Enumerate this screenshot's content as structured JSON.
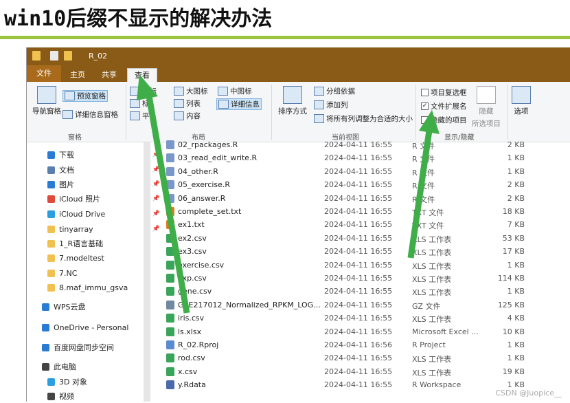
{
  "slide_title": "win10后缀不显示的解决办法",
  "window": {
    "title": "R_02"
  },
  "tabs": [
    "文件",
    "主页",
    "共享",
    "查看"
  ],
  "ribbon": {
    "pane": {
      "nav_pane": "导航窗格",
      "preview_pane": "预览窗格",
      "details_pane": "详细信息窗格",
      "group": "窗格"
    },
    "layout": {
      "medium_icons": "图标",
      "large_icons": "大图标",
      "list": "列表",
      "content": "内容",
      "tiles": "标",
      "small": "平",
      "med_icons2": "中图标",
      "details": "详细信息",
      "group": "布局"
    },
    "current_view": {
      "sort": "排序方式",
      "group_by": "分组依据",
      "add_column": "添加列",
      "fit_columns": "将所有列调整为合适的大小",
      "group": "当前视图"
    },
    "show_hide": {
      "item_checkboxes": "项目复选框",
      "file_ext": "文件扩展名",
      "hidden_items": "隐藏的项目",
      "hide": "隐藏",
      "hide_sel": "所选项目",
      "options": "选项",
      "group": "显示/隐藏"
    }
  },
  "nav": [
    {
      "label": "下载",
      "pinned": true
    },
    {
      "label": "文档",
      "pinned": true
    },
    {
      "label": "图片",
      "pinned": true
    },
    {
      "label": "iCloud 照片",
      "pinned": true
    },
    {
      "label": "iCloud Drive",
      "pinned": true
    },
    {
      "label": "tinyarray",
      "pinned": true
    },
    {
      "label": "1_R语言基础",
      "pinned": false
    },
    {
      "label": "7.modeltest",
      "pinned": false
    },
    {
      "label": "7.NC",
      "pinned": false
    },
    {
      "label": "8.maf_immu_gsva",
      "pinned": false
    },
    {
      "label": "WPS云盘",
      "pinned": false
    },
    {
      "label": "OneDrive - Personal",
      "pinned": false
    },
    {
      "label": "百度网盘同步空间",
      "pinned": false
    },
    {
      "label": "此电脑",
      "pinned": false
    },
    {
      "label": "3D 对象",
      "pinned": false
    },
    {
      "label": "视频",
      "pinned": false
    }
  ],
  "files": [
    {
      "name": "02_rpackages.R",
      "date": "2024-04-11 16:55",
      "type": "R 文件",
      "size": "2 KB",
      "icon": "r-icon"
    },
    {
      "name": "03_read_edit_write.R",
      "date": "2024-04-11 16:55",
      "type": "R 文件",
      "size": "1 KB",
      "icon": "r-icon"
    },
    {
      "name": "04_other.R",
      "date": "2024-04-11 16:55",
      "type": "R 文件",
      "size": "1 KB",
      "icon": "r-icon"
    },
    {
      "name": "05_exercise.R",
      "date": "2024-04-11 16:55",
      "type": "R 文件",
      "size": "2 KB",
      "icon": "r-icon"
    },
    {
      "name": "06_answer.R",
      "date": "2024-04-11 16:55",
      "type": "R 文件",
      "size": "2 KB",
      "icon": "r-icon"
    },
    {
      "name": "complete_set.txt",
      "date": "2024-04-11 16:55",
      "type": "TXT 文件",
      "size": "18 KB",
      "icon": "txt-icon"
    },
    {
      "name": "ex1.txt",
      "date": "2024-04-11 16:55",
      "type": "TXT 文件",
      "size": "7 KB",
      "icon": "txt-icon"
    },
    {
      "name": "ex2.csv",
      "date": "2024-04-11 16:55",
      "type": "XLS 工作表",
      "size": "53 KB",
      "icon": "csv-icon"
    },
    {
      "name": "ex3.csv",
      "date": "2024-04-11 16:55",
      "type": "XLS 工作表",
      "size": "17 KB",
      "icon": "csv-icon"
    },
    {
      "name": "exercise.csv",
      "date": "2024-04-11 16:55",
      "type": "XLS 工作表",
      "size": "1 KB",
      "icon": "csv-icon"
    },
    {
      "name": "exp.csv",
      "date": "2024-04-11 16:55",
      "type": "XLS 工作表",
      "size": "114 KB",
      "icon": "csv-icon"
    },
    {
      "name": "gene.csv",
      "date": "2024-04-11 16:55",
      "type": "XLS 工作表",
      "size": "1 KB",
      "icon": "csv-icon"
    },
    {
      "name": "GSE217012_Normalized_RPKM_LOG...",
      "date": "2024-04-11 16:55",
      "type": "GZ 文件",
      "size": "125 KB",
      "icon": "gz-icon"
    },
    {
      "name": "iris.csv",
      "date": "2024-04-11 16:55",
      "type": "XLS 工作表",
      "size": "4 KB",
      "icon": "csv-icon"
    },
    {
      "name": "ls.xlsx",
      "date": "2024-04-11 16:55",
      "type": "Microsoft Excel ...",
      "size": "10 KB",
      "icon": "csv-icon"
    },
    {
      "name": "R_02.Rproj",
      "date": "2024-04-11 16:56",
      "type": "R Project",
      "size": "1 KB",
      "icon": "rproj-icon"
    },
    {
      "name": "rod.csv",
      "date": "2024-04-11 16:55",
      "type": "XLS 工作表",
      "size": "1 KB",
      "icon": "csv-icon"
    },
    {
      "name": "x.csv",
      "date": "2024-04-11 16:55",
      "type": "XLS 工作表",
      "size": "19 KB",
      "icon": "csv-icon"
    },
    {
      "name": "y.Rdata",
      "date": "2024-04-11 16:55",
      "type": "R Workspace",
      "size": "1 KB",
      "icon": "rdata-icon"
    }
  ],
  "watermark": "CSDN @Juopice__",
  "colors": {
    "accent_green": "#3fae49",
    "titlebar": "#8a5a17",
    "title_rule": "#9cc53e"
  }
}
